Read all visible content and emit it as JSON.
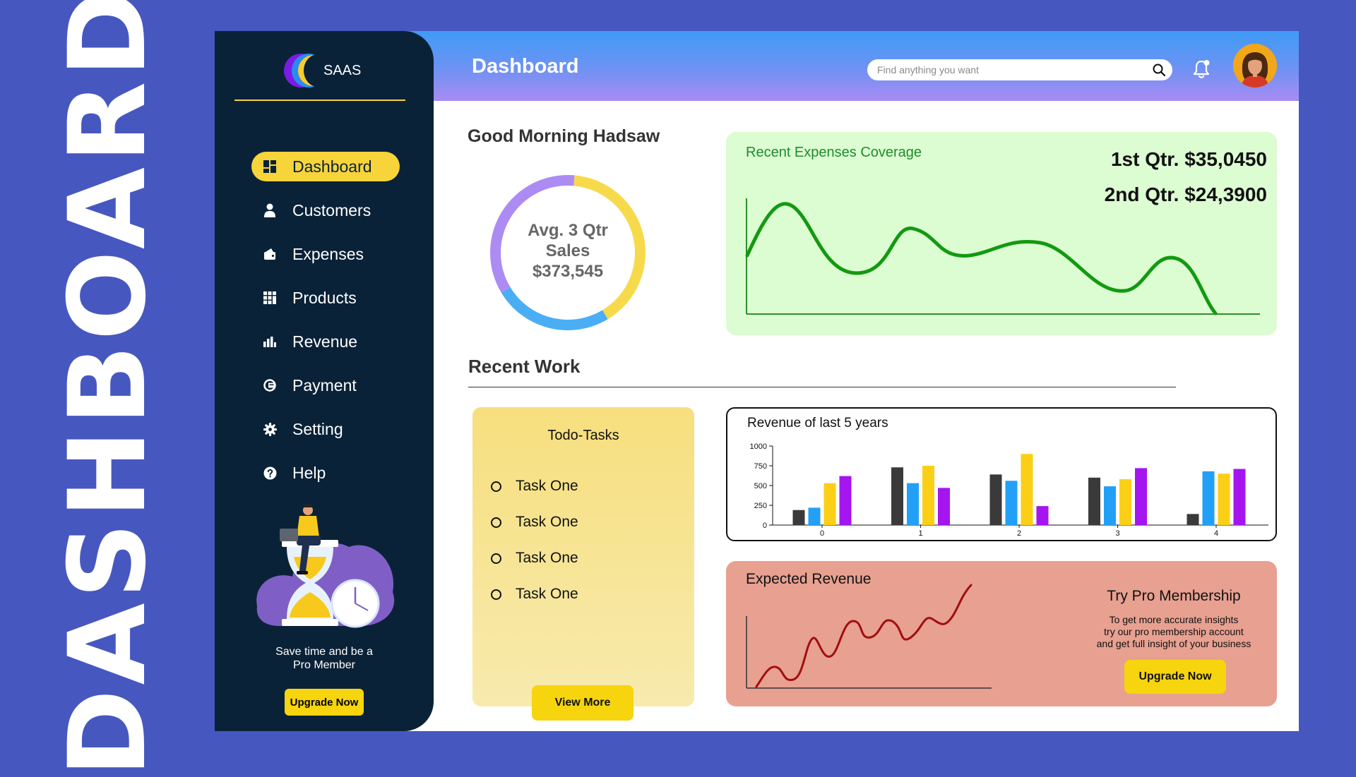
{
  "poster_title": "DASHBOARD",
  "brand": {
    "name": "SAAS"
  },
  "header": {
    "title": "Dashboard",
    "search_placeholder": "Find anything you want"
  },
  "sidebar": {
    "items": [
      {
        "label": "Dashboard",
        "icon": "dashboard-icon",
        "active": true
      },
      {
        "label": "Customers",
        "icon": "user-icon"
      },
      {
        "label": "Expenses",
        "icon": "wallet-icon"
      },
      {
        "label": "Products",
        "icon": "grid-icon"
      },
      {
        "label": "Revenue",
        "icon": "bar-chart-icon"
      },
      {
        "label": "Payment",
        "icon": "payment-icon"
      },
      {
        "label": "Setting",
        "icon": "gear-icon"
      },
      {
        "label": "Help",
        "icon": "help-icon"
      }
    ],
    "promo_text_line1": "Save time and be a",
    "promo_text_line2": "Pro Member",
    "promo_button": "Upgrade Now"
  },
  "greeting": "Good Morning Hadsaw",
  "avg_sales": {
    "line1": "Avg. 3 Qtr",
    "line2": "Sales",
    "value": "$373,545",
    "segments": [
      {
        "color": "#F7DA4C",
        "fraction": 0.4
      },
      {
        "color": "#4AAEF5",
        "fraction": 0.25
      },
      {
        "color": "#AC8CF3",
        "fraction": 0.35
      }
    ]
  },
  "expenses": {
    "title": "Recent Expenses Coverage",
    "q1": "1st Qtr. $35,0450",
    "q2": "2nd Qtr. $24,3900",
    "line_color": "#129A10"
  },
  "recent_work": {
    "title": "Recent Work"
  },
  "todo": {
    "title": "Todo-Tasks",
    "tasks": [
      "Task One",
      "Task One",
      "Task One",
      "Task One"
    ],
    "button": "View More"
  },
  "revenue": {
    "title": "Revenue of last 5 years"
  },
  "expected": {
    "title": "Expected Revenue",
    "line_color": "#A00E10",
    "pro_title": "Try Pro Membership",
    "pro_desc_line1": "To get more accurate insights",
    "pro_desc_line2": "try our pro membership account",
    "pro_desc_line3": "and get full insight of your business",
    "pro_button": "Upgrade Now"
  },
  "colors": {
    "page_bg": "#4757C0",
    "sidebar_bg": "#0A2238",
    "accent_yellow": "#F6D40E",
    "series_dark": "#3A3A3A",
    "series_blue": "#22A0F7",
    "series_yellow": "#FBCF16",
    "series_purple": "#A415F0"
  },
  "chart_data": {
    "type": "bar",
    "categories": [
      "0",
      "1",
      "2",
      "3",
      "4"
    ],
    "series": [
      {
        "values": [
          190,
          730,
          640,
          600,
          140
        ]
      },
      {
        "values": [
          220,
          530,
          560,
          490,
          680
        ]
      },
      {
        "values": [
          530,
          750,
          900,
          580,
          650
        ]
      },
      {
        "values": [
          620,
          470,
          240,
          720,
          710
        ]
      }
    ],
    "ylim": [
      0,
      1000
    ],
    "yticks": [
      0,
      250,
      500,
      750,
      1000
    ],
    "series_colors": [
      "#3A3A3A",
      "#22A0F7",
      "#FBCF16",
      "#A415F0"
    ],
    "legend": "none",
    "grid": false
  }
}
